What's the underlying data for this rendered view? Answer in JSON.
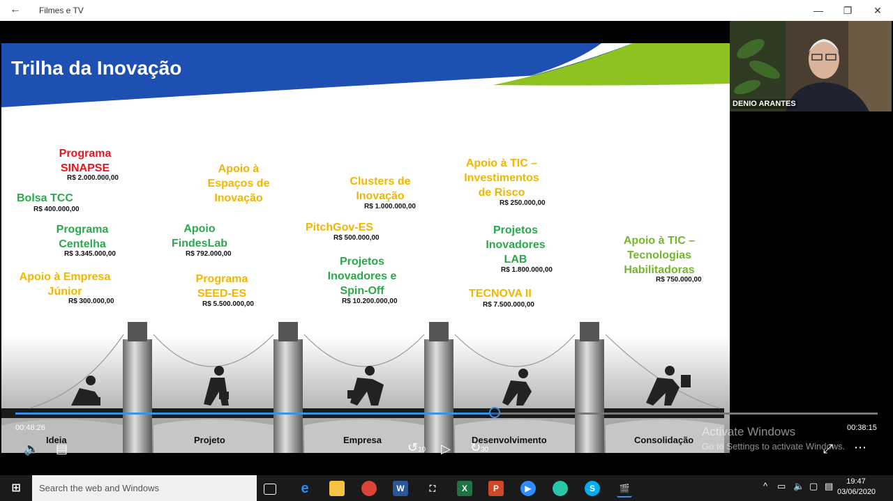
{
  "window": {
    "app_title": "Filmes e TV",
    "back_glyph": "←",
    "minimize_glyph": "—",
    "maximize_glyph": "❐",
    "close_glyph": "✕"
  },
  "slide": {
    "title": "Trilha da Inovação",
    "programs": [
      {
        "label": "Programa\nSINAPSE",
        "value": "R$ 2.000.000,00",
        "color": "#e6141e"
      },
      {
        "label": "Bolsa TCC",
        "value": "R$ 400.000,00",
        "color": "#2aa84a"
      },
      {
        "label": "Programa\nCentelha",
        "value": "R$ 3.345.000,00",
        "color": "#2aa84a"
      },
      {
        "label": "Apoio à Empresa\nJúnior",
        "value": "R$ 300.000,00",
        "color": "#f2b500"
      },
      {
        "label": "Apoio à\nEspaços de\nInovação",
        "value": "",
        "color": "#f2b500"
      },
      {
        "label": "Apoio\nFindesLab",
        "value": "R$ 792.000,00",
        "color": "#2aa84a"
      },
      {
        "label": "Programa\nSEED-ES",
        "value": "R$ 5.500.000,00",
        "color": "#f2b500"
      },
      {
        "label": "Clusters de\nInovação",
        "value": "R$ 1.000.000,00",
        "color": "#f2b500"
      },
      {
        "label": "PitchGov-ES",
        "value": "R$ 500.000,00",
        "color": "#f2b500"
      },
      {
        "label": "Projetos\nInovadores e\nSpin-Off",
        "value": "R$ 10.200.000,00",
        "color": "#2aa84a"
      },
      {
        "label": "Apoio à TIC –\nInvestimentos\nde Risco",
        "value": "R$ 250.000,00",
        "color": "#f2b500"
      },
      {
        "label": "Projetos\nInovadores\nLAB",
        "value": "R$ 1.800.000,00",
        "color": "#2aa84a"
      },
      {
        "label": "TECNOVA  II",
        "value": "R$ 7.500.000,00",
        "color": "#f2b500"
      },
      {
        "label": "Apoio à TIC –\nTecnologias\nHabilitadoras",
        "value": "R$ 750.000,00",
        "color": "#73b52d"
      }
    ],
    "stages": [
      "Ideia",
      "Projeto",
      "Empresa",
      "Desenvolvimento",
      "Consolidação"
    ]
  },
  "webcam": {
    "name": "DENIO ARANTES"
  },
  "player": {
    "elapsed": "00:48:26",
    "remaining": "00:38:15",
    "progress": 0.56,
    "skip_back_label": "10",
    "skip_forward_label": "30"
  },
  "watermark": {
    "line1": "Activate Windows",
    "line2": "Go to Settings to activate Windows."
  },
  "taskbar": {
    "search_placeholder": "Search the web and Windows",
    "time": "19:47",
    "date": "03/06/2020"
  }
}
